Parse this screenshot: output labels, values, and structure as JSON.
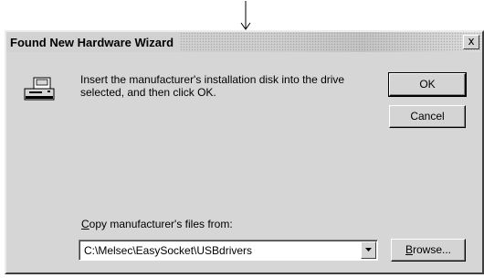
{
  "pointer": {
    "icon": "down-arrow-pointer-icon"
  },
  "window": {
    "title": "Found New Hardware Wizard",
    "close_label": "x"
  },
  "dialog": {
    "icon": "insert-disk-icon",
    "message": "Insert the manufacturer's installation disk into the drive selected, and then click OK.",
    "ok_label": "OK",
    "cancel_label": "Cancel",
    "copy_label_accel": "C",
    "copy_label_rest": "opy manufacturer's files from:",
    "path_value": "C:\\Melsec\\EasySocket\\USBdrivers",
    "dropdown_icon": "chevron-down-icon",
    "browse_label_accel": "B",
    "browse_label_rest": "rowse..."
  }
}
